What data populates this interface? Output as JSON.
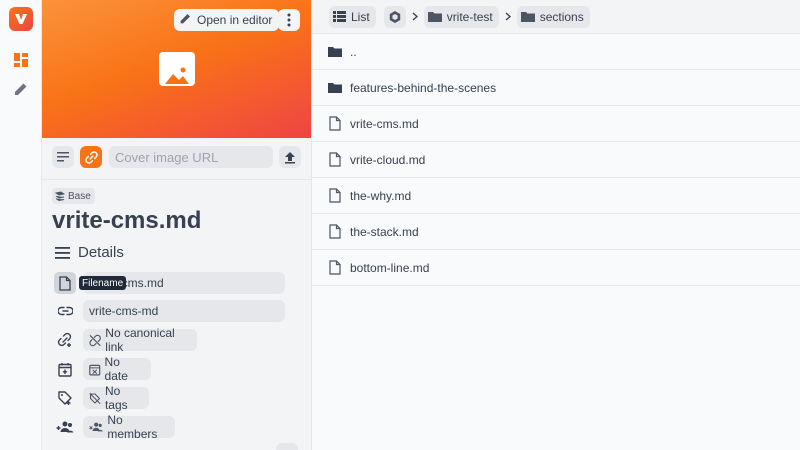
{
  "rail": {
    "icons": [
      "vrite-logo",
      "dashboard-icon",
      "pencil-icon"
    ]
  },
  "panel": {
    "open_editor_label": "Open in editor",
    "cover_placeholder": "Cover image URL",
    "base_label": "Base",
    "title": "vrite-cms.md",
    "details_label": "Details",
    "tooltip": "Filename",
    "filename_value": "vrite-cms.md",
    "slug_value": "vrite-cms-md",
    "canonical_label": "No canonical link",
    "date_label": "No date",
    "tags_label": "No tags",
    "members_label": "No members"
  },
  "toolbar": {
    "view_label": "List",
    "breadcrumbs": [
      "vrite-test",
      "sections"
    ]
  },
  "files": [
    {
      "name": "..",
      "type": "folder"
    },
    {
      "name": "features-behind-the-scenes",
      "type": "folder"
    },
    {
      "name": "vrite-cms.md",
      "type": "file"
    },
    {
      "name": "vrite-cloud.md",
      "type": "file"
    },
    {
      "name": "the-why.md",
      "type": "file"
    },
    {
      "name": "the-stack.md",
      "type": "file"
    },
    {
      "name": "bottom-line.md",
      "type": "file"
    }
  ],
  "colors": {
    "accent": "#f97316",
    "accent2": "#ef4444",
    "text": "#374151"
  }
}
